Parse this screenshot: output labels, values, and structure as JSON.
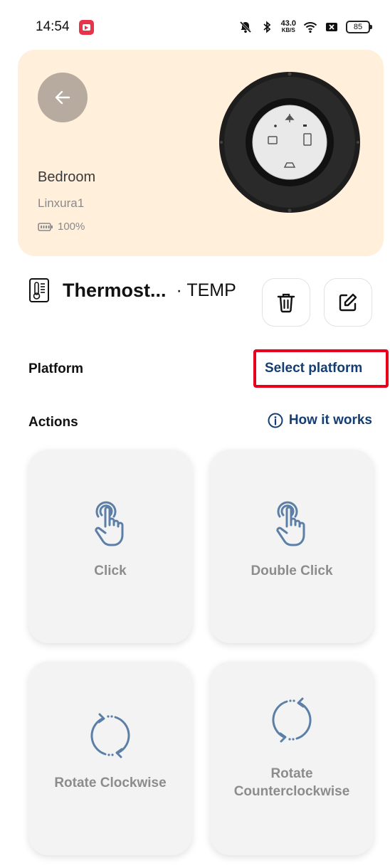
{
  "status_bar": {
    "time": "14:54",
    "net_speed_value": "43.0",
    "net_speed_unit": "KB/S",
    "battery_level": "85",
    "icons": [
      "screen-record-icon",
      "mute-bell-icon",
      "bluetooth-icon",
      "wifi-icon",
      "sim-off-icon",
      "battery-icon"
    ]
  },
  "hero": {
    "room": "Bedroom",
    "device_name": "Linxura1",
    "battery": "100%",
    "background_color": "#ffefdb"
  },
  "device": {
    "title": "Thermost...",
    "subtitle": "· TEMP"
  },
  "platform": {
    "label": "Platform",
    "select_label": "Select platform"
  },
  "actions": {
    "label": "Actions",
    "how_it_works": "How it works",
    "cards": [
      {
        "label": "Click",
        "icon": "tap-icon"
      },
      {
        "label": "Double Click",
        "icon": "double-tap-icon"
      },
      {
        "label": "Rotate Clockwise",
        "icon": "rotate-clockwise-icon"
      },
      {
        "label": "Rotate Counterclockwise",
        "icon": "rotate-counterclockwise-icon"
      }
    ]
  },
  "colors": {
    "accent": "#133e73",
    "highlight": "#e8001c",
    "icon": "#5c7fa8"
  }
}
